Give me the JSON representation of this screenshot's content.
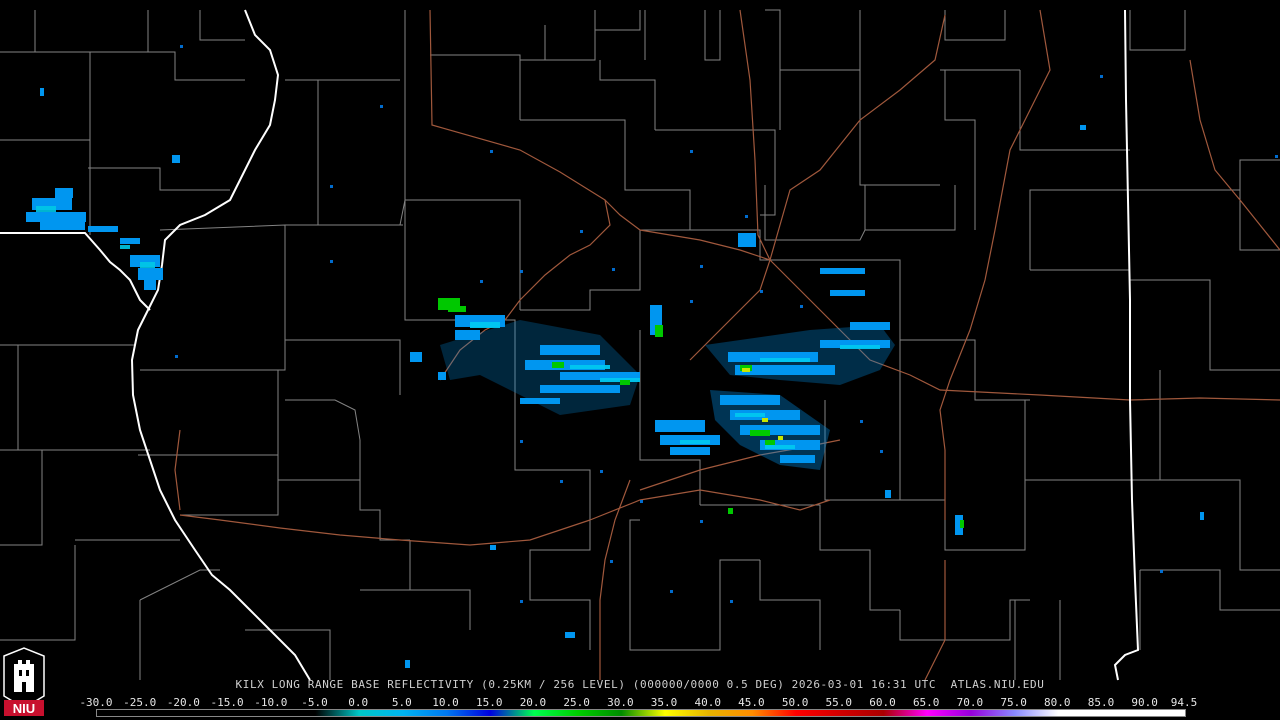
{
  "product": {
    "caption": "KILX LONG RANGE BASE REFLECTIVITY (0.25KM / 256 LEVEL) (000000/0000 0.5 DEG) 2026-03-01 16:31 UTC  ATLAS.NIU.EDU",
    "logo_text": "NIU"
  },
  "colorbar": {
    "ticks": [
      "-30.0",
      "-25.0",
      "-20.0",
      "-15.0",
      "-10.0",
      "-5.0",
      "0.0",
      "5.0",
      "10.0",
      "15.0",
      "20.0",
      "25.0",
      "30.0",
      "35.0",
      "40.0",
      "45.0",
      "50.0",
      "55.0",
      "60.0",
      "65.0",
      "70.0",
      "75.0",
      "80.0",
      "85.0",
      "90.0",
      "94.5"
    ],
    "range": [
      -30.0,
      94.5
    ],
    "stops": [
      {
        "value": -30.0,
        "color": "#000000"
      },
      {
        "value": -5.0,
        "color": "#000000"
      },
      {
        "value": 0.0,
        "color": "#00c8c8"
      },
      {
        "value": 5.0,
        "color": "#00b4f0"
      },
      {
        "value": 10.0,
        "color": "#0078f0"
      },
      {
        "value": 15.0,
        "color": "#0000e0"
      },
      {
        "value": 20.0,
        "color": "#00ff50"
      },
      {
        "value": 25.0,
        "color": "#00d000"
      },
      {
        "value": 30.0,
        "color": "#008c00"
      },
      {
        "value": 35.0,
        "color": "#ffff00"
      },
      {
        "value": 40.0,
        "color": "#e6b400"
      },
      {
        "value": 45.0,
        "color": "#ff8c00"
      },
      {
        "value": 50.0,
        "color": "#ff0000"
      },
      {
        "value": 55.0,
        "color": "#d20000"
      },
      {
        "value": 60.0,
        "color": "#aa0000"
      },
      {
        "value": 65.0,
        "color": "#ff00ff"
      },
      {
        "value": 70.0,
        "color": "#9600dc"
      },
      {
        "value": 75.0,
        "color": "#8a8aff"
      },
      {
        "value": 80.0,
        "color": "#ffffff"
      },
      {
        "value": 94.5,
        "color": "#ffffff"
      }
    ]
  },
  "colors": {
    "background": "#000000",
    "county_lines": "#b4b4b4",
    "state_lines": "#ffffff",
    "highways": "#a0583c",
    "echo_light": "#00a0e6",
    "echo_mid": "#0078e6",
    "echo_green": "#00c800",
    "echo_yellow": "#c8dc00"
  }
}
